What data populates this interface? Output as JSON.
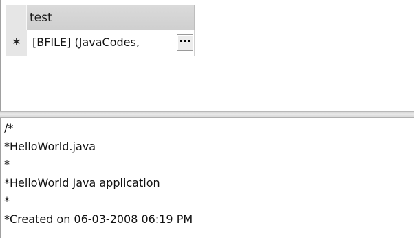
{
  "grid": {
    "column_header": "test",
    "row_indicator": "*",
    "cell_value": "[BFILE] (JavaCodes,",
    "ellipsis_label": "···"
  },
  "editor": {
    "lines": [
      "/*",
      "*HelloWorld.java",
      "*",
      "*HelloWorld Java application",
      "*",
      "*Created on 06-03-2008 06:19 PM"
    ]
  }
}
